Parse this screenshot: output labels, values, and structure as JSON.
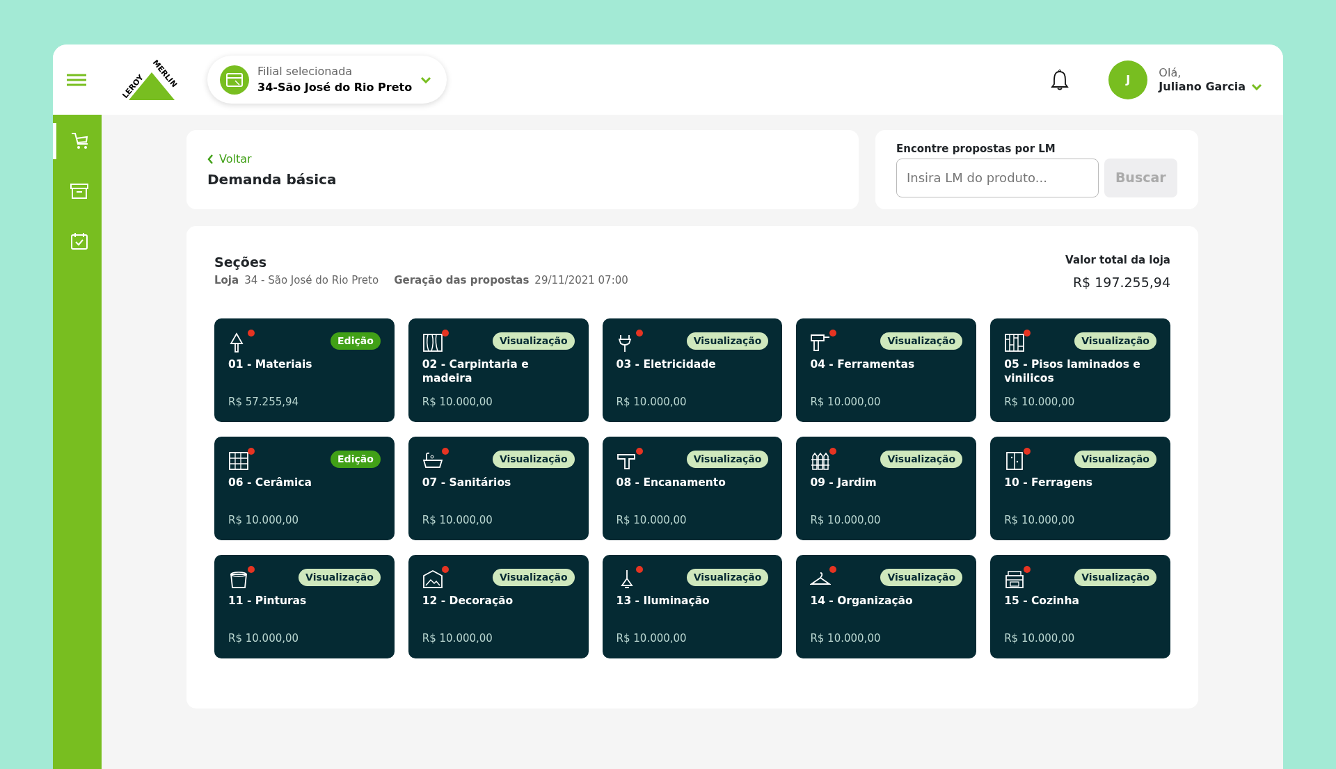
{
  "header": {
    "logo": [
      "LEROY",
      "MERLIN"
    ],
    "branch": {
      "label": "Filial selecionada",
      "value": "34-São José do Rio Preto"
    },
    "user": {
      "initial": "J",
      "greeting": "Olá,",
      "name": "Juliano Garcia"
    }
  },
  "sidebar": {
    "items": [
      {
        "selected": true
      },
      {
        "selected": false
      },
      {
        "selected": false
      }
    ]
  },
  "page": {
    "back": "Voltar",
    "title": "Demanda básica"
  },
  "search": {
    "label": "Encontre propostas por LM",
    "placeholder": "Insira LM do produto...",
    "button": "Buscar",
    "button_disabled": true
  },
  "sections": {
    "title": "Seções",
    "store_label": "Loja",
    "store_value": "34 - São José do Rio Preto",
    "generated_label": "Geração das propostas",
    "generated_value": "29/11/2021 07:00",
    "total_label": "Valor total da loja",
    "total_value": "R$ 197.255,94",
    "cards": [
      {
        "name": "01 - Materiais",
        "value": "R$ 57.255,94",
        "badge": "Edição",
        "kind": "edit"
      },
      {
        "name": "02 - Carpintaria e madeira",
        "value": "R$ 10.000,00",
        "badge": "Visualização",
        "kind": "view"
      },
      {
        "name": "03 - Eletricidade",
        "value": "R$ 10.000,00",
        "badge": "Visualização",
        "kind": "view"
      },
      {
        "name": "04 - Ferramentas",
        "value": "R$ 10.000,00",
        "badge": "Visualização",
        "kind": "view"
      },
      {
        "name": "05 - Pisos laminados e vinilicos",
        "value": "R$ 10.000,00",
        "badge": "Visualização",
        "kind": "view"
      },
      {
        "name": "06 - Cerâmica",
        "value": "R$ 10.000,00",
        "badge": "Edição",
        "kind": "edit"
      },
      {
        "name": "07 - Sanitários",
        "value": "R$ 10.000,00",
        "badge": "Visualização",
        "kind": "view"
      },
      {
        "name": "08 - Encanamento",
        "value": "R$ 10.000,00",
        "badge": "Visualização",
        "kind": "view"
      },
      {
        "name": "09 - Jardim",
        "value": "R$ 10.000,00",
        "badge": "Visualização",
        "kind": "view"
      },
      {
        "name": "10 - Ferragens",
        "value": "R$ 10.000,00",
        "badge": "Visualização",
        "kind": "view"
      },
      {
        "name": "11 - Pinturas",
        "value": "R$ 10.000,00",
        "badge": "Visualização",
        "kind": "view"
      },
      {
        "name": "12 - Decoração",
        "value": "R$ 10.000,00",
        "badge": "Visualização",
        "kind": "view"
      },
      {
        "name": "13 - Iluminação",
        "value": "R$ 10.000,00",
        "badge": "Visualização",
        "kind": "view"
      },
      {
        "name": "14 - Organização",
        "value": "R$ 10.000,00",
        "badge": "Visualização",
        "kind": "view"
      },
      {
        "name": "15 - Cozinha",
        "value": "R$ 10.000,00",
        "badge": "Visualização",
        "kind": "view"
      }
    ]
  }
}
